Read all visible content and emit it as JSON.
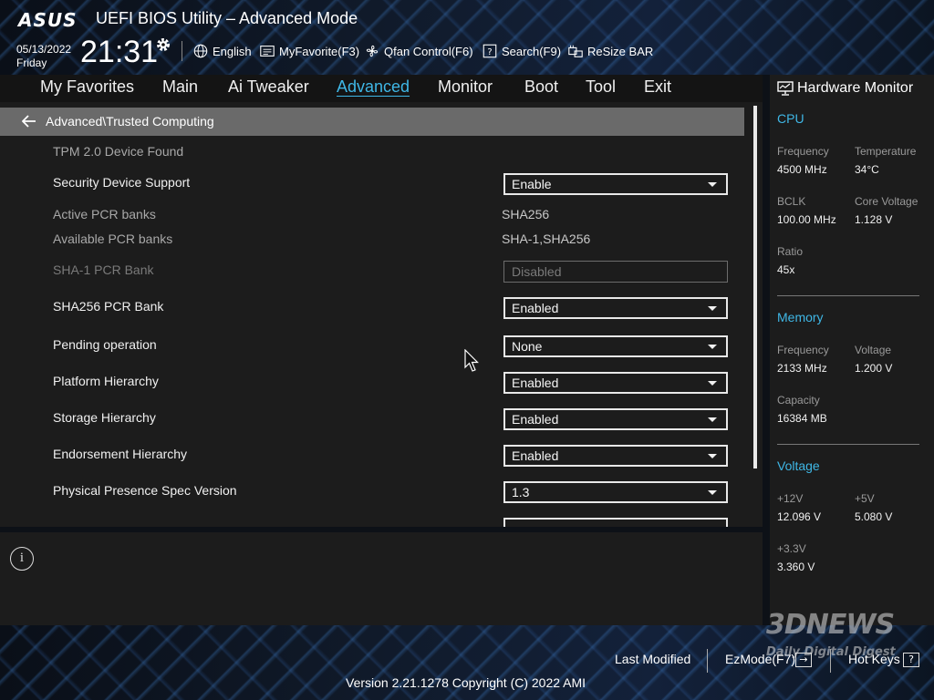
{
  "header": {
    "logo": "ASUS",
    "title": "UEFI BIOS Utility – Advanced Mode",
    "date": "05/13/2022",
    "day": "Friday",
    "time": "21:31",
    "tools": {
      "language": "English",
      "myfavorite": "MyFavorite(F3)",
      "qfan": "Qfan Control(F6)",
      "search": "Search(F9)",
      "resizebar": "ReSize BAR"
    }
  },
  "nav": {
    "items": [
      "My Favorites",
      "Main",
      "Ai Tweaker",
      "Advanced",
      "Monitor",
      "Boot",
      "Tool",
      "Exit"
    ],
    "active": "Advanced"
  },
  "breadcrumb": "Advanced\\Trusted Computing",
  "settings": {
    "tpm_found": "TPM 2.0 Device Found",
    "security_device_support": {
      "label": "Security Device Support",
      "value": "Enable"
    },
    "active_pcr_banks": {
      "label": "Active PCR banks",
      "value": "SHA256"
    },
    "available_pcr_banks": {
      "label": "Available PCR banks",
      "value": "SHA-1,SHA256"
    },
    "sha1_pcr_bank": {
      "label": "SHA-1 PCR Bank",
      "value": "Disabled"
    },
    "sha256_pcr_bank": {
      "label": "SHA256 PCR Bank",
      "value": "Enabled"
    },
    "pending_operation": {
      "label": "Pending operation",
      "value": "None"
    },
    "platform_hierarchy": {
      "label": "Platform Hierarchy",
      "value": "Enabled"
    },
    "storage_hierarchy": {
      "label": "Storage Hierarchy",
      "value": "Enabled"
    },
    "endorsement_hierarchy": {
      "label": "Endorsement Hierarchy",
      "value": "Enabled"
    },
    "physical_presence_spec": {
      "label": "Physical Presence Spec Version",
      "value": "1.3"
    }
  },
  "info_icon": "i",
  "hardware_monitor": {
    "title": "Hardware Monitor",
    "cpu": {
      "heading": "CPU",
      "frequency_label": "Frequency",
      "frequency": "4500 MHz",
      "temperature_label": "Temperature",
      "temperature": "34°C",
      "bclk_label": "BCLK",
      "bclk": "100.00 MHz",
      "core_voltage_label": "Core Voltage",
      "core_voltage": "1.128 V",
      "ratio_label": "Ratio",
      "ratio": "45x"
    },
    "memory": {
      "heading": "Memory",
      "frequency_label": "Frequency",
      "frequency": "2133 MHz",
      "voltage_label": "Voltage",
      "voltage": "1.200 V",
      "capacity_label": "Capacity",
      "capacity": "16384 MB"
    },
    "voltage": {
      "heading": "Voltage",
      "v12_label": "+12V",
      "v12": "12.096 V",
      "v5_label": "+5V",
      "v5": "5.080 V",
      "v33_label": "+3.3V",
      "v33": "3.360 V"
    }
  },
  "footer": {
    "last_modified": "Last Modified",
    "ezmode": "EzMode(F7)",
    "ezmode_icon": "→",
    "hotkeys": "Hot Keys",
    "hotkeys_icon": "?",
    "version": "Version 2.21.1278 Copyright (C) 2022 AMI"
  },
  "watermark": {
    "logo": "3DNEWS",
    "sub": "Daily Digital Digest"
  },
  "colors": {
    "accent": "#3fb7e6",
    "panel": "#1c1c1c",
    "breadcrumb": "#6a6a6a"
  }
}
